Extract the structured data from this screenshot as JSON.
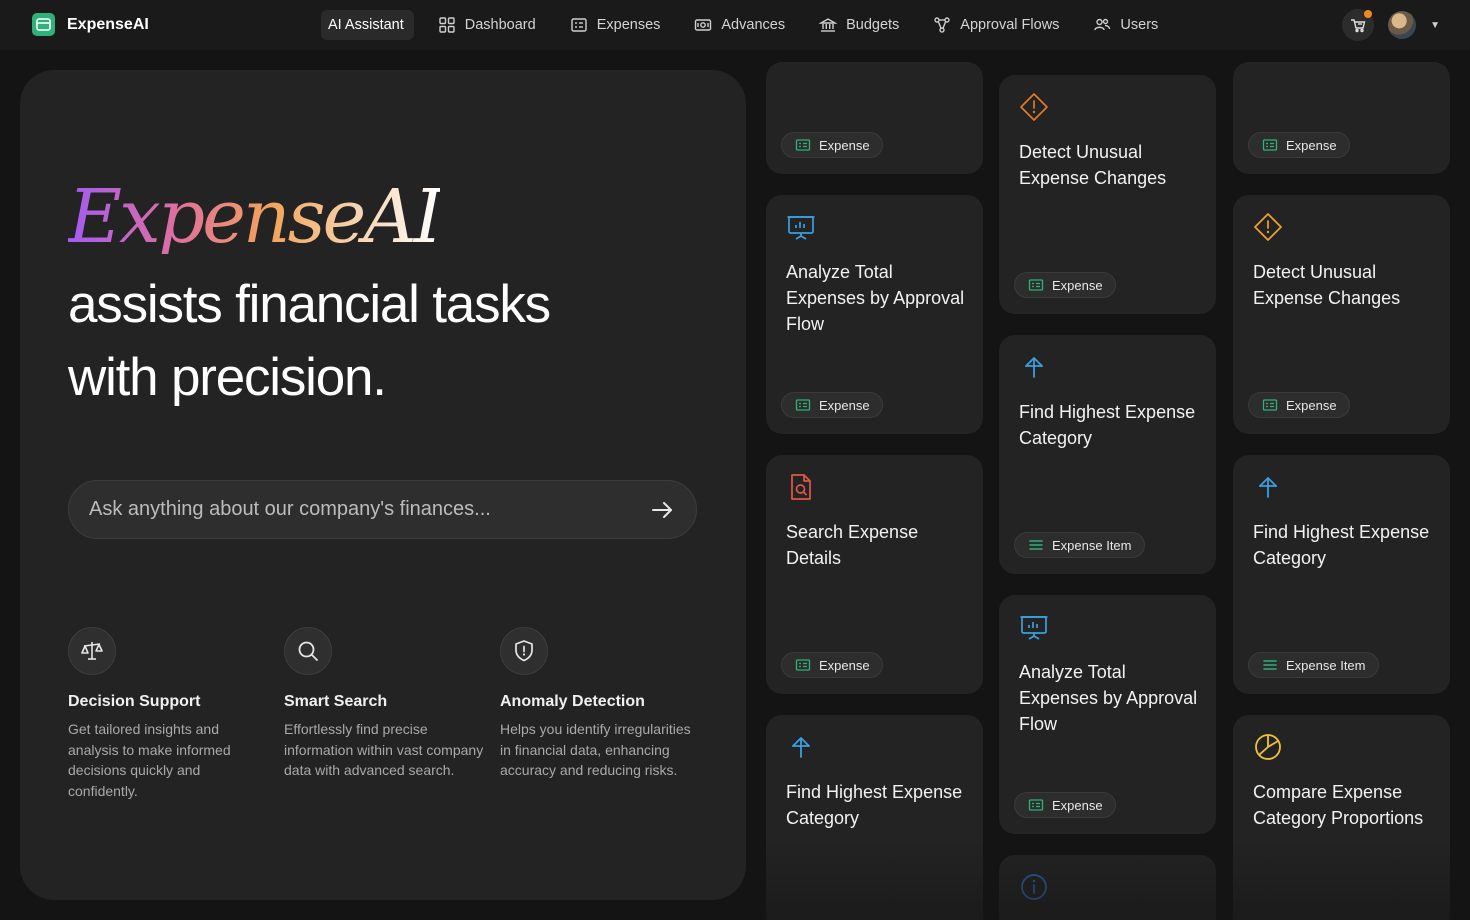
{
  "app": {
    "name": "ExpenseAI"
  },
  "nav": {
    "items": [
      {
        "label": "AI Assistant"
      },
      {
        "label": "Dashboard"
      },
      {
        "label": "Expenses"
      },
      {
        "label": "Advances"
      },
      {
        "label": "Budgets"
      },
      {
        "label": "Approval Flows"
      },
      {
        "label": "Users"
      }
    ]
  },
  "hero": {
    "brand": "ExpenseAI",
    "line1": "assists financial tasks",
    "line2": "with precision.",
    "search_placeholder": "Ask anything about our company's finances..."
  },
  "features": [
    {
      "title": "Decision Support",
      "desc": "Get tailored insights and analysis to make informed decisions quickly and confidently."
    },
    {
      "title": "Smart Search",
      "desc": "Effortlessly find precise information within vast company data with advanced search."
    },
    {
      "title": "Anomaly Detection",
      "desc": "Helps you identify irregularities in financial data, enhancing accuracy and reducing risks."
    }
  ],
  "cards": {
    "c1_tag": "Expense",
    "c2_title": "Analyze Total Expenses by Approval Flow",
    "c2_tag": "Expense",
    "c3_title": "Search Expense Details",
    "c3_tag": "Expense",
    "c4_title": "Find Highest Expense Category",
    "c5_title": "Detect Unusual Expense Changes",
    "c5_tag": "Expense",
    "c6_title": "Find Highest Expense Category",
    "c6_tag": "Expense Item",
    "c7_title": "Analyze Total Expenses by Approval Flow",
    "c7_tag": "Expense",
    "c9_tag": "Expense",
    "c10_title": "Detect Unusual Expense Changes",
    "c10_tag": "Expense",
    "c11_title": "Find Highest Expense Category",
    "c11_tag": "Expense Item",
    "c12_title": "Compare Expense Category Proportions"
  },
  "colors": {
    "accent_green": "#2fb27a",
    "warn_orange": "#f0a030",
    "info_blue": "#3aa0e0",
    "doc_red": "#e0584a",
    "chart_yellow": "#f2c230"
  }
}
